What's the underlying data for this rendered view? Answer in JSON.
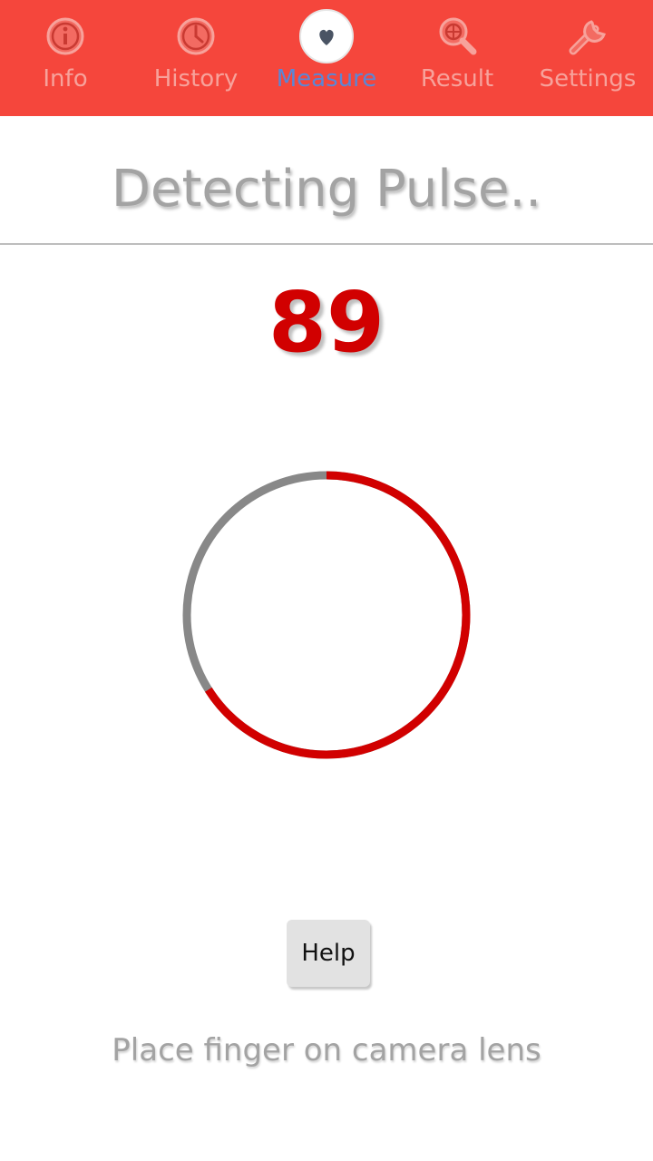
{
  "tabs": [
    {
      "label": "Info",
      "icon": "info-icon"
    },
    {
      "label": "History",
      "icon": "clock-icon"
    },
    {
      "label": "Measure",
      "icon": "heart-icon",
      "active": true
    },
    {
      "label": "Result",
      "icon": "magnifier-icon"
    },
    {
      "label": "Settings",
      "icon": "wrench-icon"
    }
  ],
  "status": {
    "title": "Detecting Pulse.."
  },
  "reading": {
    "value": "89",
    "progress_fraction": 0.66
  },
  "help": {
    "label": "Help"
  },
  "hint": {
    "text": "Place finger on camera lens"
  },
  "colors": {
    "tab_bar": "#f5463c",
    "tab_label_inactive": "#f7a29b",
    "tab_label_active": "#5a87d6",
    "reading": "#d10000",
    "ring_progress": "#d10000",
    "ring_track": "#888888"
  }
}
